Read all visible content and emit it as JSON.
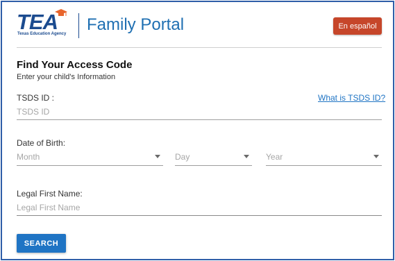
{
  "header": {
    "logo_text": "TEA",
    "logo_tagline": "Texas Education Agency",
    "portal_title": "Family Portal",
    "language_button": "En español",
    "colors": {
      "brand_blue": "#1b4b8f",
      "title_blue": "#1f6fb2",
      "lang_button": "#c6462a",
      "cap_orange": "#e8652c"
    }
  },
  "form": {
    "heading": "Find Your Access Code",
    "subheading": "Enter your child's Information",
    "tsds": {
      "label": "TSDS ID :",
      "placeholder": "TSDS ID",
      "help_link": "What is TSDS ID?"
    },
    "dob": {
      "label": "Date of Birth:",
      "month_placeholder": "Month",
      "day_placeholder": "Day",
      "year_placeholder": "Year"
    },
    "first_name": {
      "label": "Legal First Name:",
      "placeholder": "Legal First Name"
    },
    "search_button": "SEARCH",
    "colors": {
      "primary": "#1f74c4"
    }
  }
}
